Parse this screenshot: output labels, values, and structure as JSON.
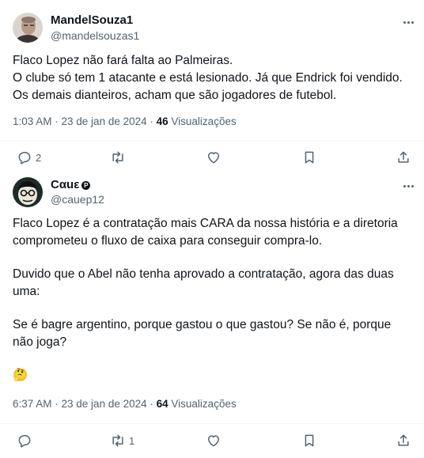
{
  "tweets": [
    {
      "name": "MandelSouza1",
      "handle": "@mandelsouzas1",
      "lines": [
        "Flaco Lopez não fará falta ao Palmeiras.",
        "O clube só tem 1 atacante e está lesionado. Já que Endrick foi vendido.",
        "Os demais dianteiros, acham que são jogadores de futebol."
      ],
      "timestamp": "1:03 AM · 23 de jan de 2024 · ",
      "views_count": "46",
      "views_label": " Visualizações",
      "replies": "2",
      "reposts": "",
      "avatar_icon": "user-avatar-photo"
    },
    {
      "name": "Cαuε",
      "verified_glyph": "P",
      "handle": "@cauep12",
      "paragraphs": [
        "Flaco Lopez é a contratação mais CARA da nossa história e a diretoria comprometeu o fluxo de caixa para conseguir compra-lo.",
        "Duvido que o Abel não tenha aprovado a contratação, agora das duas uma:",
        "Se é bagre argentino, porque gastou o que gastou? Se não é, porque não joga?",
        "🤔"
      ],
      "timestamp": "6:37 AM · 23 de jan de 2024 · ",
      "views_count": "64",
      "views_label": " Visualizações",
      "replies": "",
      "reposts": "1",
      "avatar_icon": "cartoon-avatar"
    }
  ],
  "colors": {
    "text": "#0f1419",
    "secondary": "#536471",
    "separator": "#eff3f4"
  }
}
